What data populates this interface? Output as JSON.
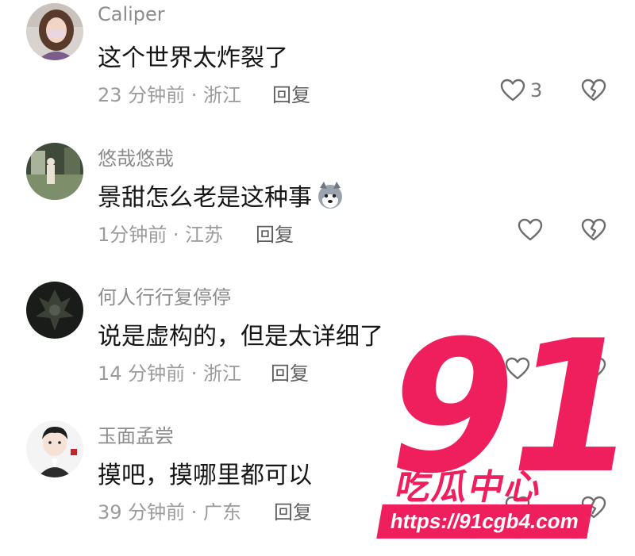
{
  "comments": [
    {
      "username": "Caliper",
      "text": "这个世界太炸裂了",
      "time": "23 分钟前 · 浙江",
      "reply_label": "回复",
      "likes": "3",
      "avatar_icon": "woman-photo-avatar"
    },
    {
      "username": "悠哉悠哉",
      "text": "景甜怎么老是这种事",
      "emoji_icon": "husky-dog-emoji",
      "time": "1分钟前 · 江苏",
      "reply_label": "回复",
      "likes": "",
      "avatar_icon": "room-photo-avatar"
    },
    {
      "username": "何人行行复停停",
      "text": "说是虚构的，但是太详细了",
      "time": "14 分钟前 · 浙江",
      "reply_label": "回复",
      "likes": "",
      "avatar_icon": "dark-figure-avatar"
    },
    {
      "username": "玉面孟尝",
      "text": "摸吧，摸哪里都可以",
      "time": "39 分钟前 · 广东",
      "reply_label": "回复",
      "likes": "",
      "avatar_icon": "cartoon-man-avatar"
    }
  ],
  "watermark": {
    "number": "91",
    "name": "吃瓜中心",
    "url": "https://91cgb4.com",
    "color": "#ef1f5e"
  },
  "colors": {
    "username": "#8c8c8c",
    "text": "#161616",
    "meta": "#9b9b9b"
  }
}
